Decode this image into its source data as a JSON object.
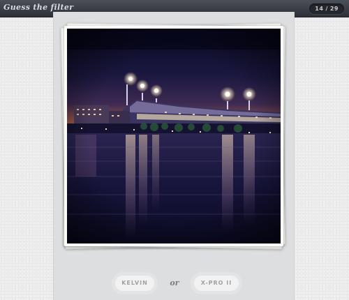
{
  "app": {
    "title": "Guess the filter"
  },
  "progress": {
    "current": "14",
    "separator": "/",
    "total": "29"
  },
  "photo": {
    "subject": "stadium-at-night-by-river"
  },
  "choices": {
    "option_a": "KELVIN",
    "separator": "or",
    "option_b": "X-PRO II"
  },
  "colors": {
    "topbar": "#3a3d45",
    "background": "#ececec",
    "panel": "#dddee0",
    "button_text": "#9fa1a6"
  }
}
